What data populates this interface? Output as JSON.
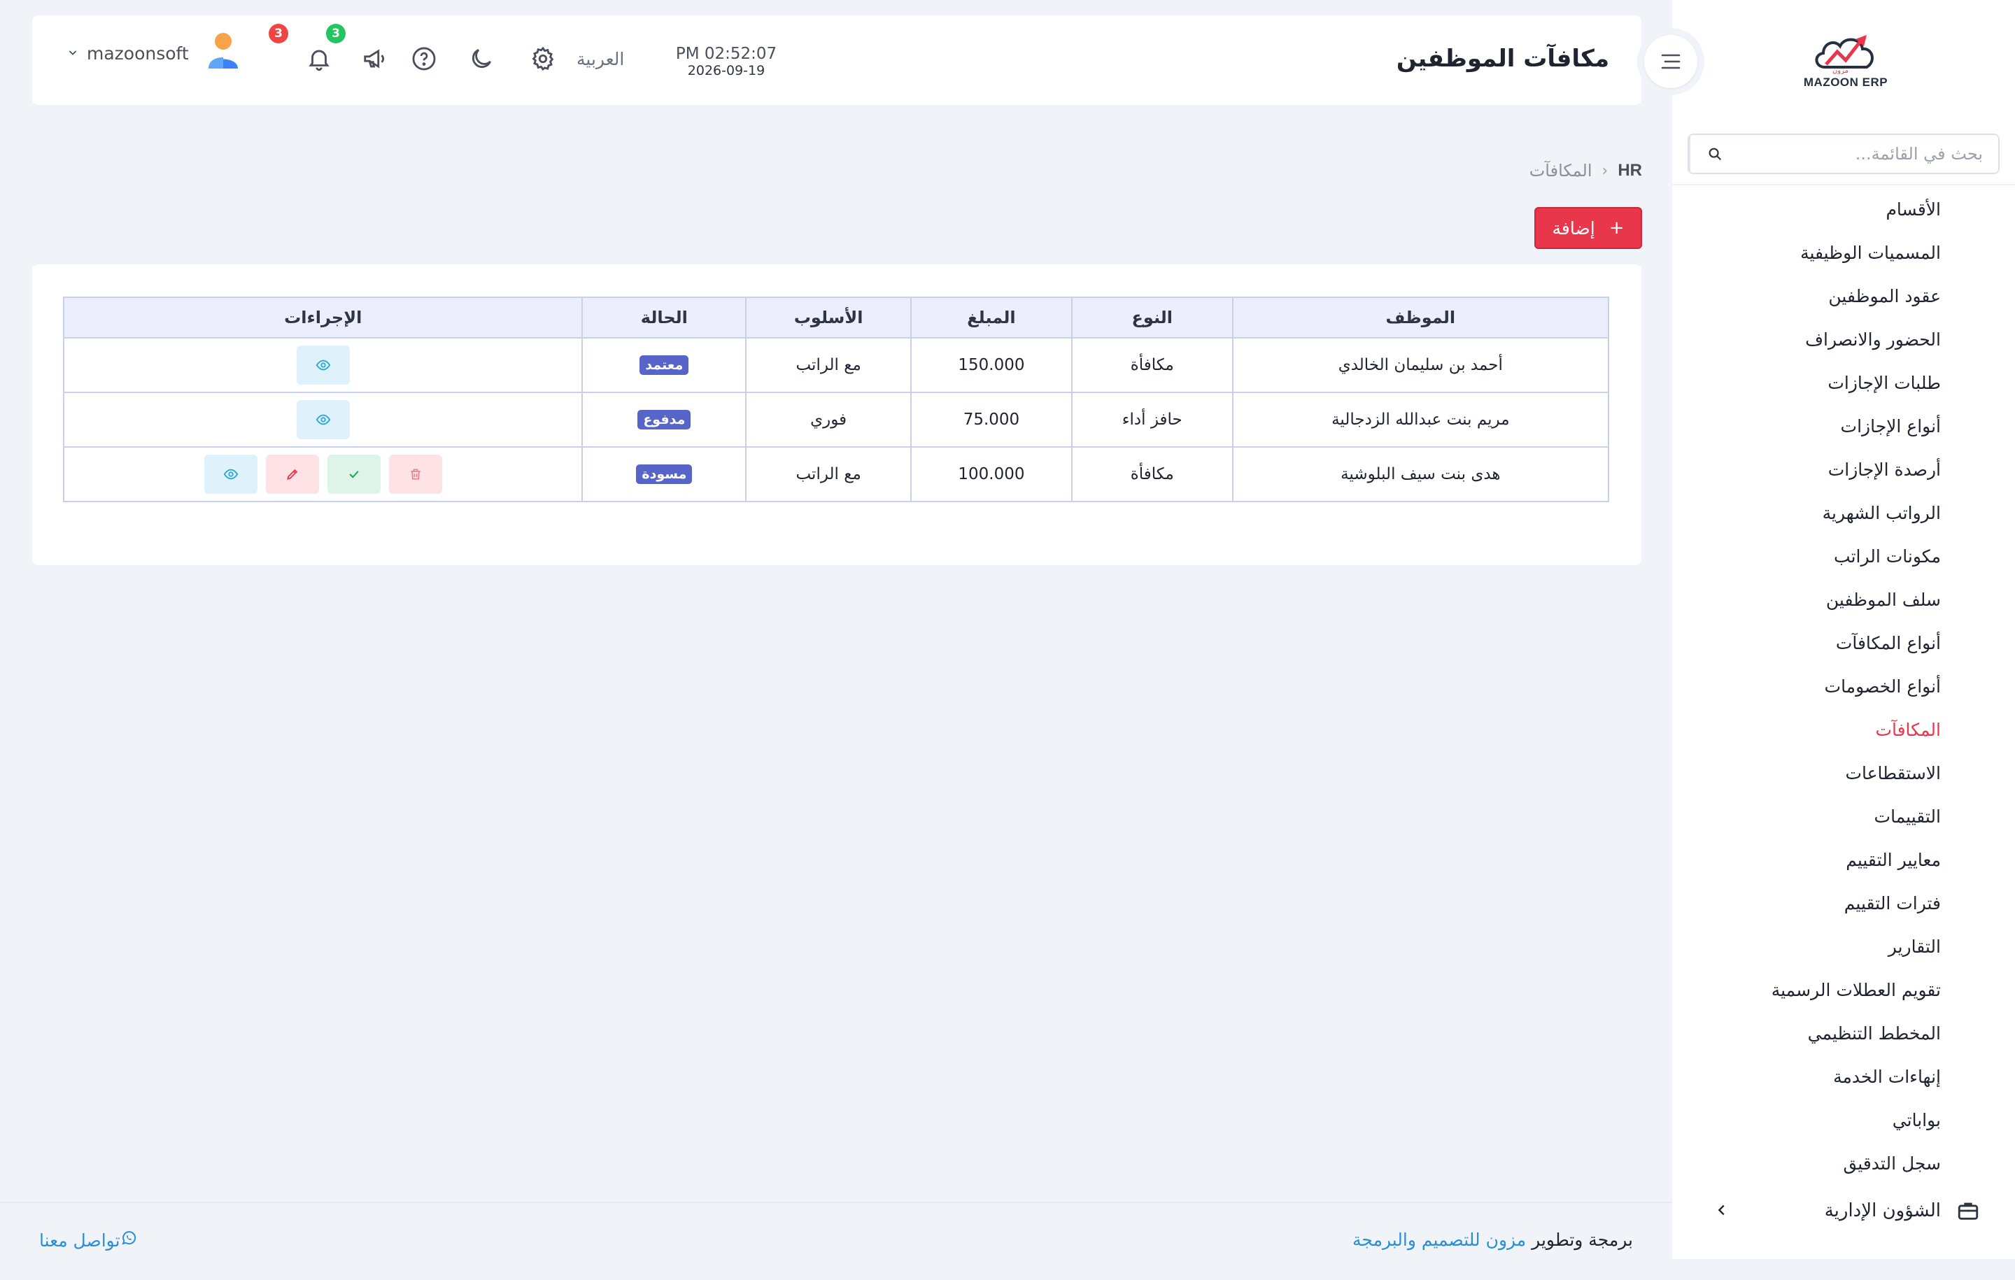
{
  "brand": {
    "logo_text": "MAZOON ERP",
    "logo_sub": "مزون"
  },
  "sidebar": {
    "search_placeholder": "بحث في القائمة...",
    "items": [
      {
        "label": "الأقسام"
      },
      {
        "label": "المسميات الوظيفية"
      },
      {
        "label": "عقود الموظفين"
      },
      {
        "label": "الحضور والانصراف"
      },
      {
        "label": "طلبات الإجازات"
      },
      {
        "label": "أنواع الإجازات"
      },
      {
        "label": "أرصدة الإجازات"
      },
      {
        "label": "الرواتب الشهرية"
      },
      {
        "label": "مكونات الراتب"
      },
      {
        "label": "سلف الموظفين"
      },
      {
        "label": "أنواع المكافآت"
      },
      {
        "label": "أنواع الخصومات"
      },
      {
        "label": "المكافآت",
        "active": true
      },
      {
        "label": "الاستقطاعات"
      },
      {
        "label": "التقييمات"
      },
      {
        "label": "معايير التقييم"
      },
      {
        "label": "فترات التقييم"
      },
      {
        "label": "التقارير"
      },
      {
        "label": "تقويم العطلات الرسمية"
      },
      {
        "label": "المخطط التنظيمي"
      },
      {
        "label": "إنهاءات الخدمة"
      },
      {
        "label": "بواباتي"
      },
      {
        "label": "سجل التدقيق"
      }
    ],
    "section": {
      "label": "الشؤون الإدارية",
      "icon": "briefcase-icon"
    }
  },
  "header": {
    "title": "مكافآت الموظفين",
    "time": "PM 02:52:07",
    "date": "2026-09-19",
    "language": "العربية",
    "notifications_count": "3",
    "announcements_count": "3",
    "username": "mazoonsoft",
    "colors": {
      "notif_badge": "#ef4444",
      "announce_badge": "#22c55e"
    }
  },
  "breadcrumb": {
    "root": "HR",
    "current": "المكافآت"
  },
  "add_button": {
    "label": "إضافة"
  },
  "table": {
    "headers": [
      "الموظف",
      "النوع",
      "المبلغ",
      "الأسلوب",
      "الحالة",
      "الإجراءات"
    ],
    "rows": [
      {
        "employee": "أحمد بن سليمان الخالدي",
        "type": "مكافأة",
        "amount": "150.000",
        "method": "مع الراتب",
        "status": "معتمد",
        "actions": [
          "view"
        ]
      },
      {
        "employee": "مريم بنت عبدالله الزدجالية",
        "type": "حافز أداء",
        "amount": "75.000",
        "method": "فوري",
        "status": "مدفوع",
        "actions": [
          "view"
        ]
      },
      {
        "employee": "هدى بنت سيف البلوشية",
        "type": "مكافأة",
        "amount": "100.000",
        "method": "مع الراتب",
        "status": "مسودة",
        "actions": [
          "view",
          "edit",
          "approve",
          "delete"
        ]
      }
    ]
  },
  "footer": {
    "credit_prefix": "برمجة وتطوير",
    "credit_brand": "مزون للتصميم والبرمجة",
    "contact": "تواصل معنا"
  },
  "colors": {
    "accent": "#e8364a",
    "link": "#2a8fd6",
    "status_badge": "#5865c8",
    "table_head_bg": "#eceefd"
  }
}
